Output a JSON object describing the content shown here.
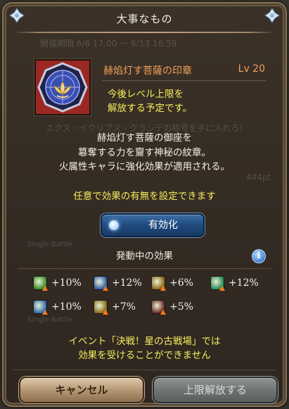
{
  "modal": {
    "title": "大事なもの"
  },
  "background_ghost_text": {
    "line1": "開催期間  6/6 17:00 ～ 6/13 16:59",
    "line2": "エクス・イクリプス・グランデの称号を手に入れろ!",
    "line3": "Single Battle",
    "line4": "444pt",
    "line5": "Single Battle"
  },
  "item": {
    "name": "赫焰灯す菩薩の印章",
    "level": "Lv 20",
    "note_line1": "今後レベル上限を",
    "note_line2": "解放する予定です。",
    "icon": "lotus-seal-icon"
  },
  "description": {
    "line1": "赫焰灯す菩薩の御座を",
    "line2": "簒奪する力を齎す神秘の紋章。",
    "line3": "火属性キャラに強化効果が適用される。"
  },
  "optional_text": "任意で効果の有無を設定できます",
  "toggle": {
    "label": "有効化"
  },
  "effects": {
    "title": "発動中の効果",
    "items": [
      {
        "icon": "attack-up-icon",
        "value": "+10%",
        "color": "#3c8a2a"
      },
      {
        "icon": "defense-up-icon",
        "value": "+12%",
        "color": "#2d5fa8"
      },
      {
        "icon": "double-attack-up-icon",
        "value": "+6%",
        "color": "#8a6a1a"
      },
      {
        "icon": "hp-up-icon",
        "value": "+12%",
        "color": "#2a8a5a"
      },
      {
        "icon": "charge-bar-up-icon",
        "value": "+10%",
        "color": "#2d6aa8"
      },
      {
        "icon": "triple-attack-up-icon",
        "value": "+7%",
        "color": "#8a6a1a"
      },
      {
        "icon": "critical-up-icon",
        "value": "+5%",
        "color": "#6a2a2a"
      }
    ]
  },
  "warning": {
    "line1": "イベント「決戦！星の古戦場」では",
    "line2": "効果を受けることができません"
  },
  "buttons": {
    "cancel": "キャンセル",
    "unlock": "上限解放する"
  }
}
